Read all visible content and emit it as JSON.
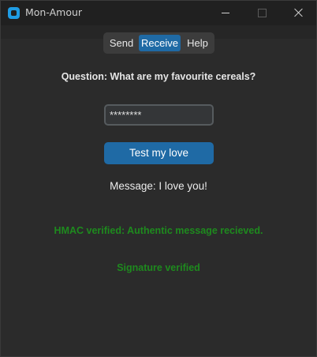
{
  "window": {
    "title": "Mon-Amour",
    "icon": "app-logo-icon",
    "controls": {
      "minimize_icon": "minimize-icon",
      "maximize_icon": "maximize-icon",
      "close_icon": "close-icon"
    }
  },
  "tabs": [
    {
      "label": "Send",
      "selected": false
    },
    {
      "label": "Receive",
      "selected": true
    },
    {
      "label": "Help",
      "selected": false
    }
  ],
  "form": {
    "question": "Question: What are my favourite cereals?",
    "password_value": "********",
    "test_button_label": "Test my love"
  },
  "results": {
    "message": "Message: I love you!",
    "hmac_status": "HMAC verified: Authentic message recieved.",
    "signature_status": "Signature verified"
  },
  "colors": {
    "accent": "#1f6aa5",
    "success": "#1e8a1e",
    "background": "#2b2b2b"
  }
}
